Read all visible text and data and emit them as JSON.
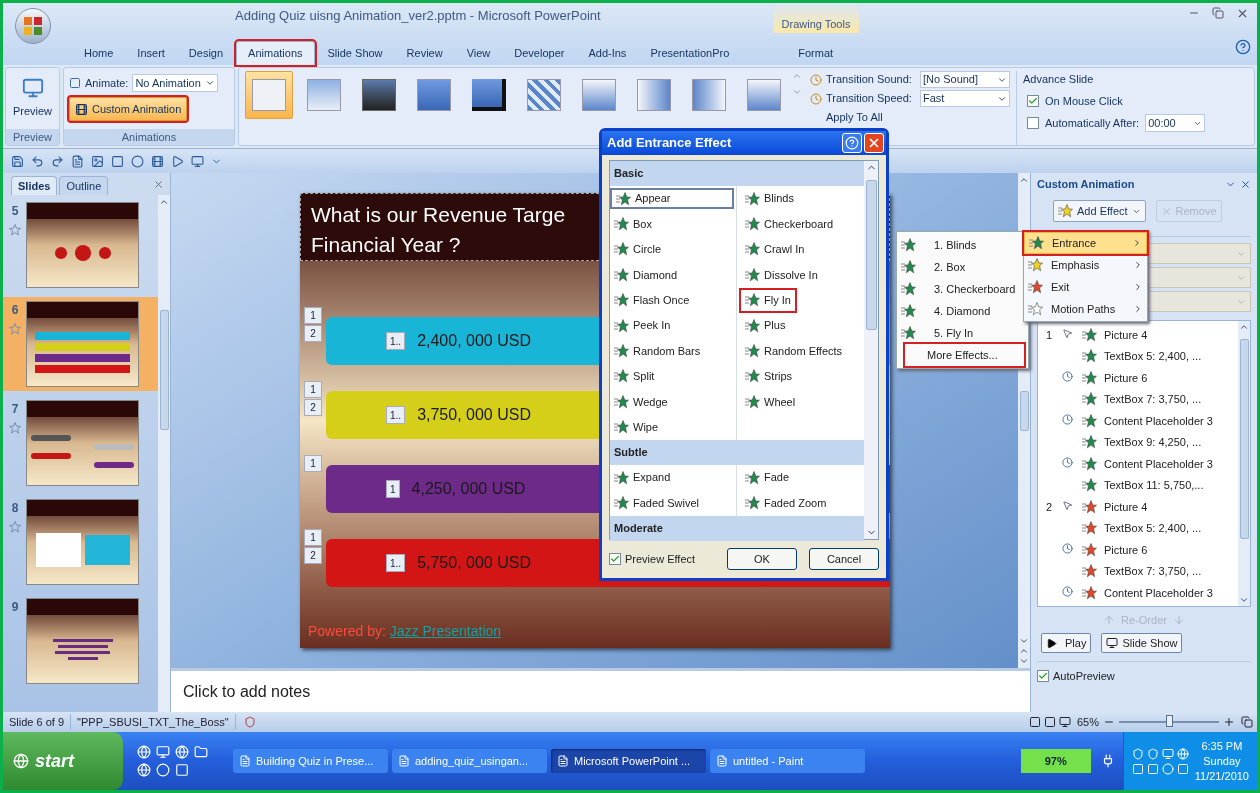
{
  "window": {
    "title": "Adding Quiz uisng Animation_ver2.pptm - Microsoft PowerPoint",
    "contextual_group": "Drawing Tools"
  },
  "tabs": [
    {
      "label": "Home",
      "kind": "normal",
      "selected": false,
      "annotated": false
    },
    {
      "label": "Insert",
      "kind": "normal",
      "selected": false,
      "annotated": false
    },
    {
      "label": "Design",
      "kind": "normal",
      "selected": false,
      "annotated": false
    },
    {
      "label": "Animations",
      "kind": "normal",
      "selected": true,
      "annotated": true
    },
    {
      "label": "Slide Show",
      "kind": "normal",
      "selected": false,
      "annotated": false
    },
    {
      "label": "Review",
      "kind": "normal",
      "selected": false,
      "annotated": false
    },
    {
      "label": "View",
      "kind": "normal",
      "selected": false,
      "annotated": false
    },
    {
      "label": "Developer",
      "kind": "normal",
      "selected": false,
      "annotated": false
    },
    {
      "label": "Add-Ins",
      "kind": "normal",
      "selected": false,
      "annotated": false
    },
    {
      "label": "PresentationPro",
      "kind": "normal",
      "selected": false,
      "annotated": false
    },
    {
      "label": "Format",
      "kind": "contextual",
      "selected": false,
      "annotated": false
    }
  ],
  "ribbon": {
    "preview_group": {
      "button": "Preview",
      "label": "Preview"
    },
    "animations_group": {
      "animate_label": "Animate:",
      "animate_value": "No Animation",
      "custom_animation": {
        "label": "Custom Animation",
        "annotated": true
      },
      "label": "Animations"
    },
    "transitions": [
      {
        "kind": "plain",
        "selected": true
      },
      {
        "kind": "fade",
        "selected": false
      },
      {
        "kind": "dark",
        "selected": false
      },
      {
        "kind": "push",
        "selected": false
      },
      {
        "kind": "shadow",
        "selected": false
      },
      {
        "kind": "checker",
        "selected": false
      },
      {
        "kind": "down",
        "selected": false
      },
      {
        "kind": "left",
        "selected": false
      },
      {
        "kind": "right",
        "selected": false
      },
      {
        "kind": "up",
        "selected": false
      }
    ],
    "transition_sound": {
      "label": "Transition Sound:",
      "value": "[No Sound]"
    },
    "transition_speed": {
      "label": "Transition Speed:",
      "value": "Fast"
    },
    "apply_to_all": "Apply To All",
    "advance_slide": {
      "title": "Advance Slide",
      "on_mouse_click": {
        "label": "On Mouse Click",
        "checked": true
      },
      "automatically_after": {
        "label": "Automatically After:",
        "checked": false,
        "value": "00:00"
      }
    }
  },
  "slides_panel": {
    "tabs": [
      {
        "label": "Slides",
        "selected": true
      },
      {
        "label": "Outline",
        "selected": false
      }
    ],
    "slides": [
      {
        "number": "5",
        "animated": true,
        "selected": false,
        "kind": "diagram"
      },
      {
        "number": "6",
        "animated": true,
        "selected": true,
        "kind": "bars"
      },
      {
        "number": "7",
        "animated": true,
        "selected": false,
        "kind": "lines"
      },
      {
        "number": "8",
        "animated": true,
        "selected": false,
        "kind": "text"
      },
      {
        "number": "9",
        "animated": false,
        "selected": false,
        "kind": "closing"
      }
    ]
  },
  "slide": {
    "title_lines": [
      "What is our Revenue Targe",
      "Financial Year ?"
    ],
    "bars": [
      {
        "color": "#19b5d6",
        "tags": [
          "1",
          "2"
        ],
        "inner_tag": "1..",
        "value": "2,400, 000 USD"
      },
      {
        "color": "#d6cf1a",
        "tags": [
          "1",
          "2"
        ],
        "inner_tag": "1..",
        "value": "3,750, 000 USD"
      },
      {
        "color": "#6e2a88",
        "tags": [
          "1"
        ],
        "inner_tag": "1",
        "value": "4,250, 000 USD"
      },
      {
        "color": "#d41515",
        "tags": [
          "1",
          "2"
        ],
        "inner_tag": "1..",
        "value": "5,750, 000 USD"
      }
    ],
    "footer": {
      "prefix": "Powered by:",
      "link": "Jazz Presentation"
    }
  },
  "notes_placeholder": "Click to add notes",
  "task_pane": {
    "title": "Custom Animation",
    "add_effect": "Add Effect",
    "remove": {
      "label": "Remove",
      "disabled": true
    },
    "animations": [
      {
        "order": "1",
        "on_click": true,
        "after_previous": false,
        "kind": "entrance",
        "label": "Picture 4"
      },
      {
        "on_click": false,
        "after_previous": false,
        "kind": "entrance",
        "label": "TextBox 5: 2,400, ..."
      },
      {
        "on_click": false,
        "after_previous": true,
        "kind": "entrance",
        "label": "Picture 6"
      },
      {
        "on_click": false,
        "after_previous": false,
        "kind": "entrance",
        "label": "TextBox 7: 3,750, ..."
      },
      {
        "on_click": false,
        "after_previous": true,
        "kind": "entrance",
        "label": "Content Placeholder 3"
      },
      {
        "on_click": false,
        "after_previous": false,
        "kind": "entrance",
        "label": "TextBox 9: 4,250, ..."
      },
      {
        "on_click": false,
        "after_previous": true,
        "kind": "entrance",
        "label": "Content Placeholder 3"
      },
      {
        "on_click": false,
        "after_previous": false,
        "kind": "entrance",
        "label": "TextBox 11: 5,750,..."
      },
      {
        "order": "2",
        "on_click": true,
        "after_previous": false,
        "kind": "exit",
        "label": "Picture 4"
      },
      {
        "on_click": false,
        "after_previous": false,
        "kind": "exit",
        "label": "TextBox 5: 2,400, ..."
      },
      {
        "on_click": false,
        "after_previous": true,
        "kind": "exit",
        "label": "Picture 6"
      },
      {
        "on_click": false,
        "after_previous": false,
        "kind": "exit",
        "label": "TextBox 7: 3,750, ..."
      },
      {
        "on_click": false,
        "after_previous": true,
        "kind": "exit",
        "label": "Content Placeholder 3"
      }
    ],
    "reorder": "Re-Order",
    "play": "Play",
    "slide_show": "Slide Show",
    "autopreview": {
      "label": "AutoPreview",
      "checked": true
    }
  },
  "add_effect_menu": [
    {
      "label": "Entrance",
      "kind": "entrance",
      "selected": true,
      "annotated": true
    },
    {
      "label": "Emphasis",
      "kind": "emphasis",
      "selected": false,
      "annotated": false
    },
    {
      "label": "Exit",
      "kind": "exit",
      "selected": false,
      "annotated": false
    },
    {
      "label": "Motion Paths",
      "kind": "motion",
      "selected": false,
      "annotated": false
    }
  ],
  "entrance_submenu": {
    "items": [
      "1. Blinds",
      "2. Box",
      "3. Checkerboard",
      "4. Diamond",
      "5. Fly In"
    ],
    "more": {
      "label": "More Effects...",
      "annotated": true
    }
  },
  "dialog": {
    "title": "Add Entrance Effect",
    "sections": [
      {
        "title": "Basic",
        "effects": [
          {
            "label": "Appear",
            "selected": true,
            "annotated": false
          },
          {
            "label": "Blinds",
            "selected": false,
            "annotated": false
          },
          {
            "label": "Box",
            "selected": false,
            "annotated": false
          },
          {
            "label": "Checkerboard",
            "selected": false,
            "annotated": false
          },
          {
            "label": "Circle",
            "selected": false,
            "annotated": false
          },
          {
            "label": "Crawl In",
            "selected": false,
            "annotated": false
          },
          {
            "label": "Diamond",
            "selected": false,
            "annotated": false
          },
          {
            "label": "Dissolve In",
            "selected": false,
            "annotated": false
          },
          {
            "label": "Flash Once",
            "selected": false,
            "annotated": false
          },
          {
            "label": "Fly In",
            "selected": false,
            "annotated": true
          },
          {
            "label": "Peek In",
            "selected": false,
            "annotated": false
          },
          {
            "label": "Plus",
            "selected": false,
            "annotated": false
          },
          {
            "label": "Random Bars",
            "selected": false,
            "annotated": false
          },
          {
            "label": "Random Effects",
            "selected": false,
            "annotated": false
          },
          {
            "label": "Split",
            "selected": false,
            "annotated": false
          },
          {
            "label": "Strips",
            "selected": false,
            "annotated": false
          },
          {
            "label": "Wedge",
            "selected": false,
            "annotated": false
          },
          {
            "label": "Wheel",
            "selected": false,
            "annotated": false
          },
          {
            "label": "Wipe",
            "selected": false,
            "annotated": false
          }
        ]
      },
      {
        "title": "Subtle",
        "effects": [
          {
            "label": "Expand",
            "selected": false,
            "annotated": false
          },
          {
            "label": "Fade",
            "selected": false,
            "annotated": false
          },
          {
            "label": "Faded Swivel",
            "selected": false,
            "annotated": false
          },
          {
            "label": "Faded Zoom",
            "selected": false,
            "annotated": false
          }
        ]
      },
      {
        "title": "Moderate"
      }
    ],
    "preview_effect": {
      "label": "Preview Effect",
      "checked": true
    },
    "ok": "OK",
    "cancel": "Cancel"
  },
  "status_bar": {
    "slide": "Slide 6 of 9",
    "theme": "\"PPP_SBUSI_TXT_The_Boss\"",
    "zoom": {
      "label": "65%",
      "level": 0.5
    }
  },
  "taskbar": {
    "start": "start",
    "tasks": [
      {
        "label": "Building Quiz in Prese...",
        "selected": false
      },
      {
        "label": "adding_quiz_usingan...",
        "selected": false
      },
      {
        "label": "Microsoft PowerPoint ...",
        "selected": true
      },
      {
        "label": "untitled - Paint",
        "selected": false
      }
    ],
    "battery": "97%",
    "clock": [
      "6:35 PM",
      "Sunday",
      "11/21/2010"
    ]
  }
}
